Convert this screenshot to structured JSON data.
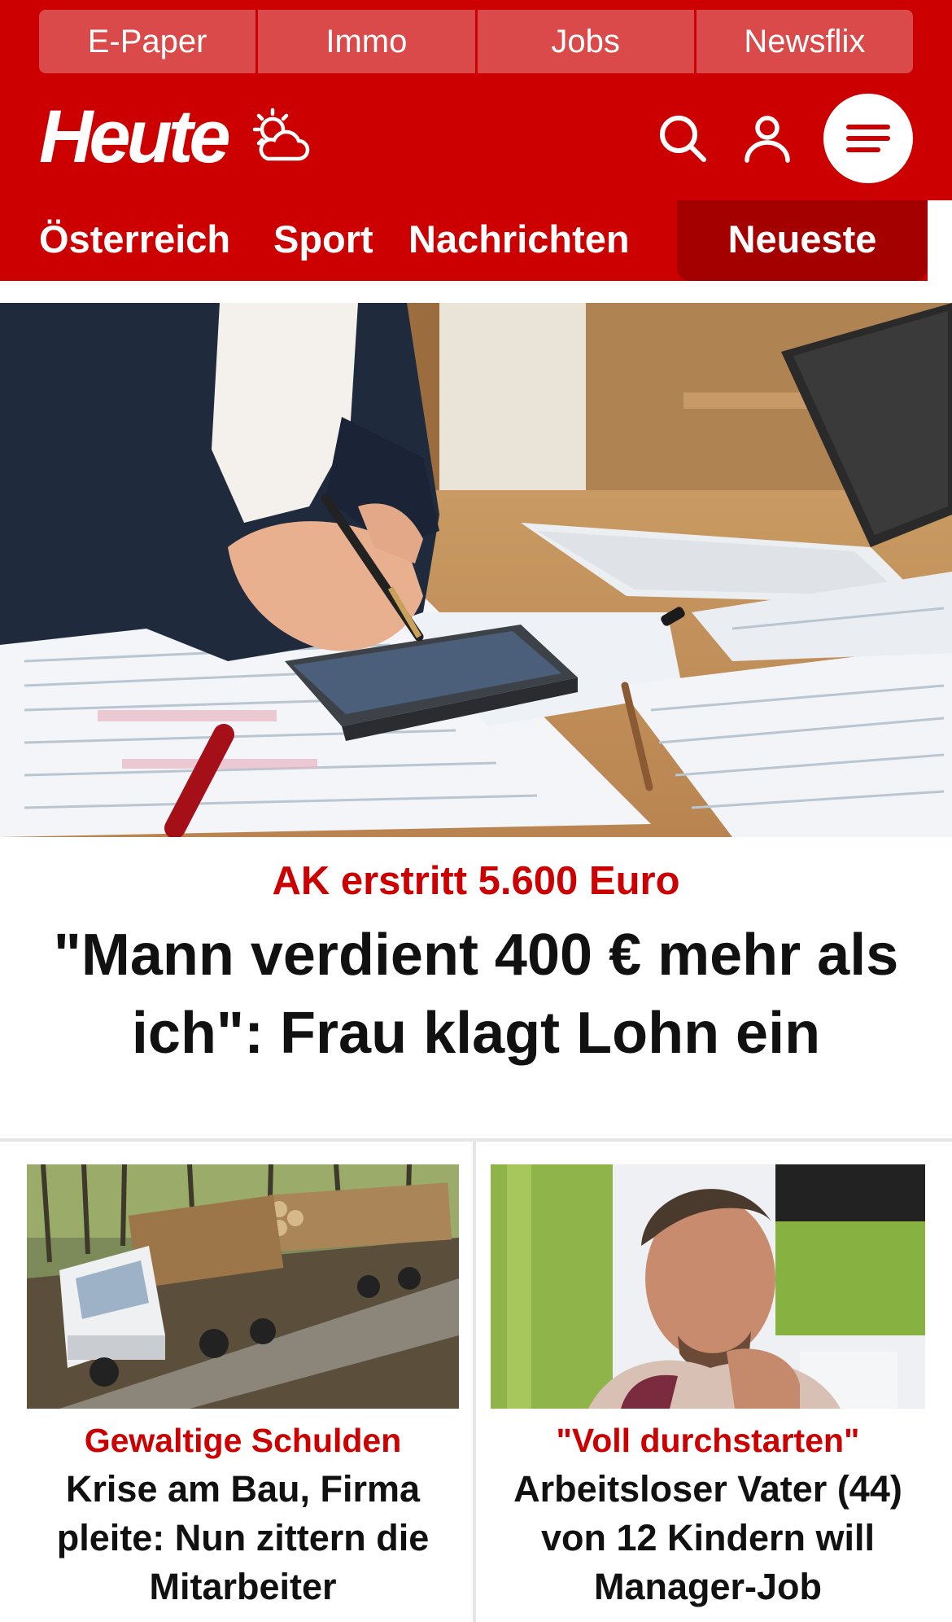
{
  "topnav": {
    "items": [
      "E-Paper",
      "Immo",
      "Jobs",
      "Newsflix"
    ]
  },
  "brand": {
    "logo": "Heute",
    "weather_icon": "partly-cloudy-sun-icon",
    "search_icon": "search-icon",
    "user_icon": "user-icon",
    "menu_icon": "hamburger-menu-icon"
  },
  "sections": {
    "items": [
      "Österreich",
      "Sport",
      "Nachrichten"
    ],
    "active": "Neueste"
  },
  "hero": {
    "kicker": "AK erstritt 5.600 Euro",
    "title": "\"Mann verdient 400 € mehr als ich\": Frau klagt Lohn ein"
  },
  "cards": [
    {
      "kicker": "Gewaltige Schulden",
      "title": "Krise am Bau, Firma pleite: Nun zittern die Mitarbeiter"
    },
    {
      "kicker": "\"Voll durchstarten\"",
      "title": "Arbeitsloser Vater (44) von 12 Kindern will Manager-Job"
    }
  ],
  "colors": {
    "brand_red": "#cc0000",
    "active_tab": "#a50000",
    "top_tab": "#db4a4a"
  }
}
